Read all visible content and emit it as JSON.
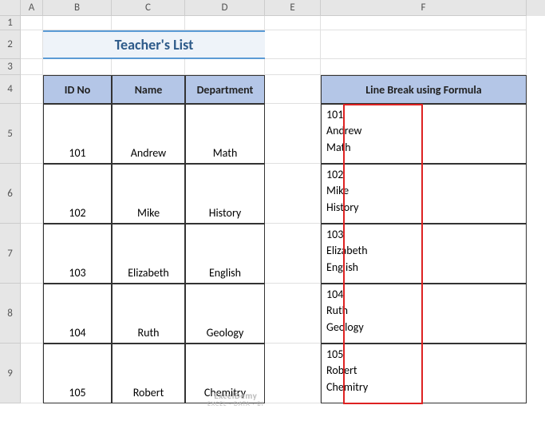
{
  "columns": [
    "A",
    "B",
    "C",
    "D",
    "E",
    "F"
  ],
  "rows": [
    "1",
    "2",
    "3",
    "4",
    "5",
    "6",
    "7",
    "8",
    "9"
  ],
  "title": "Teacher's List",
  "headers": {
    "id": "ID No",
    "name": "Name",
    "dept": "Department"
  },
  "formula_header": "Line Break using Formula",
  "teachers": [
    {
      "id": "101",
      "name": "Andrew",
      "dept": "Math"
    },
    {
      "id": "102",
      "name": "Mike",
      "dept": "History"
    },
    {
      "id": "103",
      "name": "Elizabeth",
      "dept": "English"
    },
    {
      "id": "104",
      "name": "Ruth",
      "dept": "Geology"
    },
    {
      "id": "105",
      "name": "Robert",
      "dept": "Chemitry"
    }
  ],
  "watermark": {
    "top": "ExcelDemy",
    "bottom": "EXCEL · DATA · BI"
  }
}
